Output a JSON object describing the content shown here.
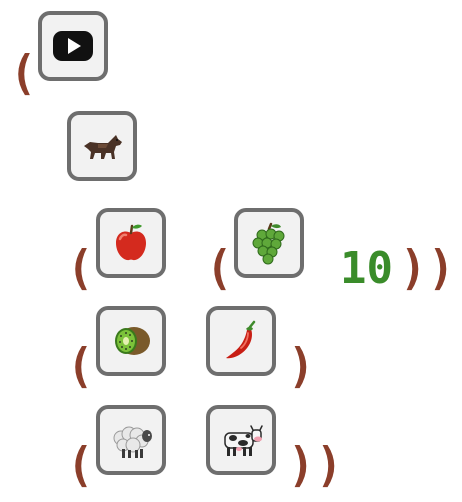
{
  "expression": {
    "open_paren": "(",
    "close_paren": ")",
    "number_literal": "10"
  },
  "blocks": [
    {
      "name": "play-button-icon"
    },
    {
      "name": "wolf-icon"
    },
    {
      "name": "apple-icon"
    },
    {
      "name": "grapes-icon"
    },
    {
      "name": "kiwi-icon"
    },
    {
      "name": "chili-pepper-icon"
    },
    {
      "name": "sheep-icon"
    },
    {
      "name": "cow-icon"
    }
  ],
  "colors": {
    "paren": "#8b3e2a",
    "number": "#3a8c2a",
    "block_border": "#6e6e6e",
    "block_background": "#f2f2f2"
  }
}
